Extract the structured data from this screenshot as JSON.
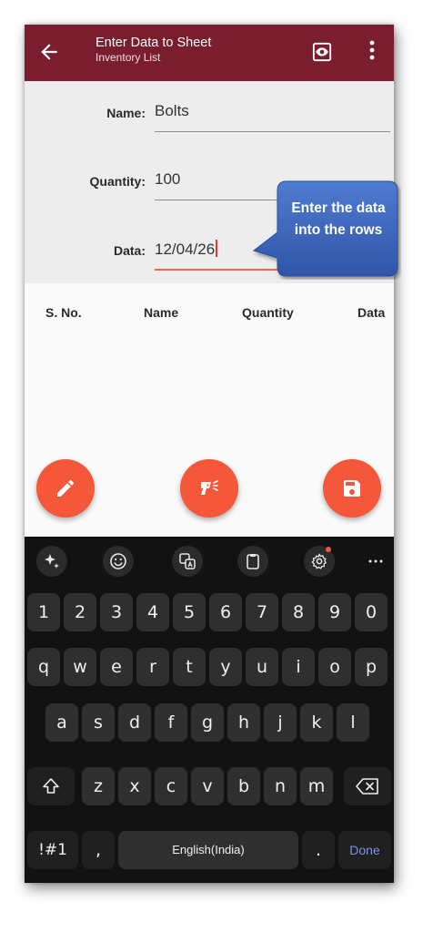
{
  "appbar": {
    "title": "Enter Data to Sheet",
    "subtitle": "Inventory List",
    "color": "#7a1e2f"
  },
  "form": {
    "name_label": "Name:",
    "name_value": "Bolts",
    "quantity_label": "Quantity:",
    "quantity_value": "100",
    "data_label": "Data:",
    "data_value": "12/04/26"
  },
  "table": {
    "headers": [
      "S. No.",
      "Name",
      "Quantity",
      "Data"
    ]
  },
  "callout": {
    "text": "Enter the data into the rows",
    "color": "#3b63b8"
  },
  "fabs": {
    "edit_icon": "pencil-icon",
    "scan_icon": "scanner-icon",
    "save_icon": "floppy-disk-icon",
    "color": "#f4573a"
  },
  "keyboard": {
    "toolbar": [
      "sparkle-icon",
      "emoji-icon",
      "translate-icon",
      "clipboard-icon",
      "settings-icon",
      "more-icon"
    ],
    "row_numbers": [
      "1",
      "2",
      "3",
      "4",
      "5",
      "6",
      "7",
      "8",
      "9",
      "0"
    ],
    "row_q": [
      "q",
      "w",
      "e",
      "r",
      "t",
      "y",
      "u",
      "i",
      "o",
      "p"
    ],
    "row_a": [
      "a",
      "s",
      "d",
      "f",
      "g",
      "h",
      "j",
      "k",
      "l"
    ],
    "row_z": [
      "z",
      "x",
      "c",
      "v",
      "b",
      "n",
      "m"
    ],
    "symbols_key": "!#1",
    "comma_key": ",",
    "space_key": "English(India)",
    "period_key": ".",
    "done_key": "Done"
  }
}
